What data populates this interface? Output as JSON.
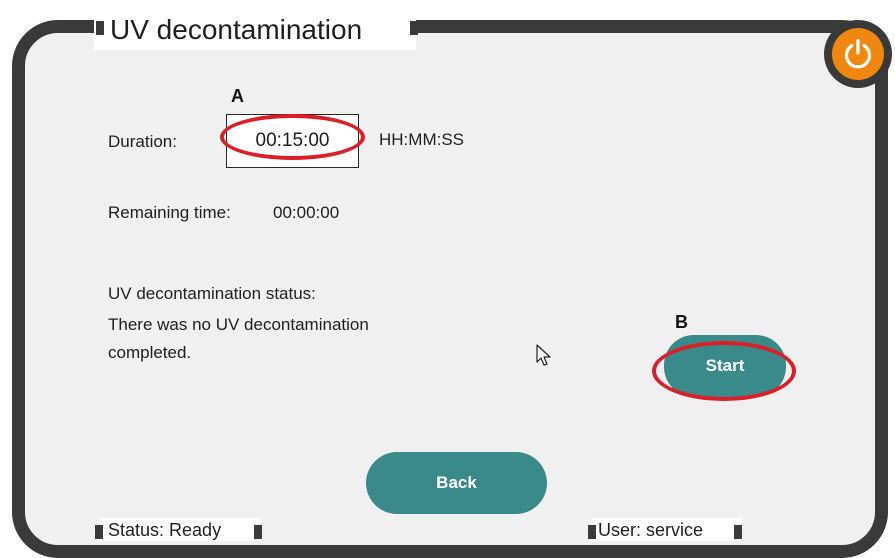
{
  "window": {
    "title": "UV decontamination"
  },
  "power": {
    "icon": "power-icon",
    "color": "#f0880f"
  },
  "markers": {
    "a": "A",
    "b": "B"
  },
  "duration": {
    "label": "Duration:",
    "value": "00:15:00",
    "unit": "HH:MM:SS"
  },
  "remaining": {
    "label": "Remaining time:",
    "value": "00:00:00"
  },
  "uv_status": {
    "heading": "UV decontamination status:",
    "line1": "There was no UV decontamination",
    "line2": "completed."
  },
  "buttons": {
    "start_label": "Start",
    "back_label": "Back",
    "color": "#3a8a8a"
  },
  "highlight_color": "#dc1e28",
  "footer": {
    "status": "Status: Ready",
    "user": "User: service"
  }
}
